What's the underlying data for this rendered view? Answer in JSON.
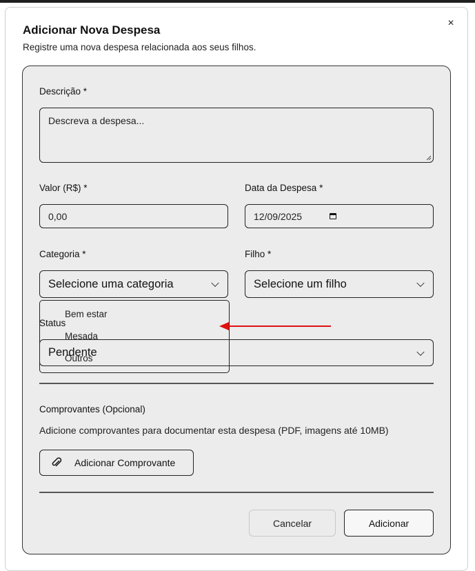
{
  "dialog": {
    "title": "Adicionar Nova Despesa",
    "subtitle": "Registre uma nova despesa relacionada aos seus filhos.",
    "close_glyph": "×"
  },
  "form": {
    "descricao": {
      "label": "Descrição *",
      "placeholder": "Descreva a despesa..."
    },
    "valor": {
      "label": "Valor (R$) *",
      "value": "0,00"
    },
    "data": {
      "label": "Data da Despesa *",
      "value": "12/09/2025"
    },
    "categoria": {
      "label": "Categoria *",
      "selected": "Selecione uma categoria",
      "options": [
        "Bem estar",
        "Mesada",
        "Outros"
      ]
    },
    "filho": {
      "label": "Filho *",
      "selected": "Selecione um filho"
    },
    "status": {
      "label": "Status",
      "selected": "Pendente"
    },
    "comprovantes": {
      "label": "Comprovantes (Opcional)",
      "help": "Adicione comprovantes para documentar esta despesa (PDF, imagens até 10MB)",
      "button": "Adicionar Comprovante"
    }
  },
  "actions": {
    "cancel": "Cancelar",
    "submit": "Adicionar"
  },
  "icons": {
    "close": "close-icon",
    "calendar": "calendar-icon",
    "chevron": "chevron-down-icon",
    "clip": "paperclip-icon",
    "annotation": "red-arrow-annotation"
  },
  "colors": {
    "card_bg": "#ececec",
    "annotation": "#e01010"
  }
}
